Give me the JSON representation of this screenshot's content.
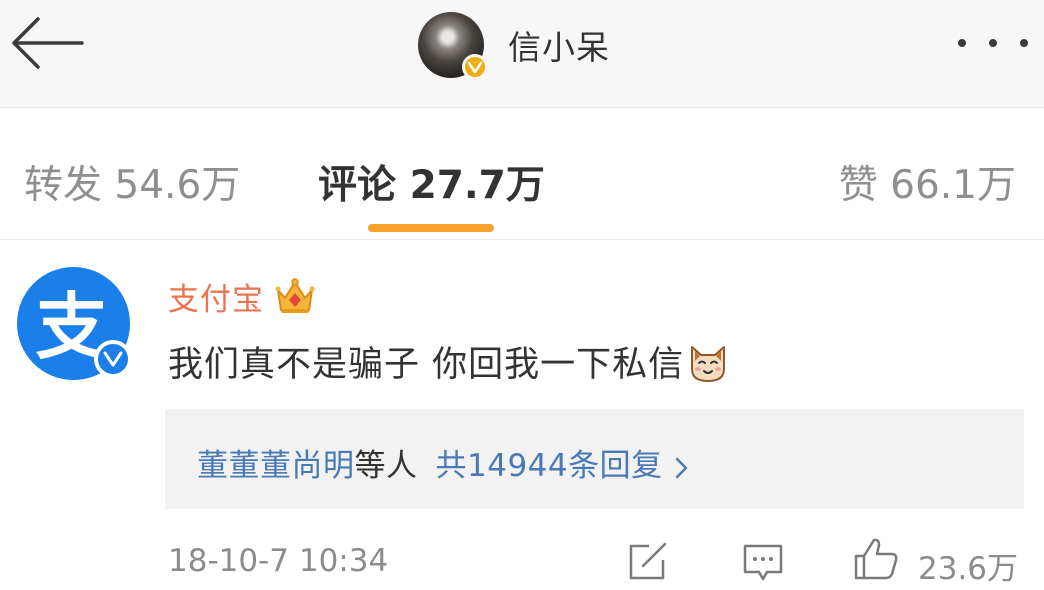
{
  "header": {
    "user_name": "信小呆",
    "back_icon": "arrow-left-icon",
    "more_icon": "more-dots-icon",
    "verified_badge_color": "#f0ad12"
  },
  "tabs": [
    {
      "label": "转发",
      "count": "54.6万",
      "active": false
    },
    {
      "label": "评论",
      "count": "27.7万",
      "active": true
    },
    {
      "label": "赞",
      "count": "66.1万",
      "active": false
    }
  ],
  "accent_color": "#f7a12d",
  "comment": {
    "author": "支付宝",
    "author_color": "#eb7350",
    "avatar_glyph": "支",
    "avatar_color": "#1a7fe8",
    "badge_icon": "crown-icon",
    "text": "我们真不是骗子 你回我一下私信",
    "emoji_icon": "cat-face-icon",
    "replies": {
      "users": "董董董尚明",
      "mid": "等人",
      "count_label": "共14944条回复"
    },
    "time": "18-10-7 10:34",
    "like_count": "23.6万"
  }
}
